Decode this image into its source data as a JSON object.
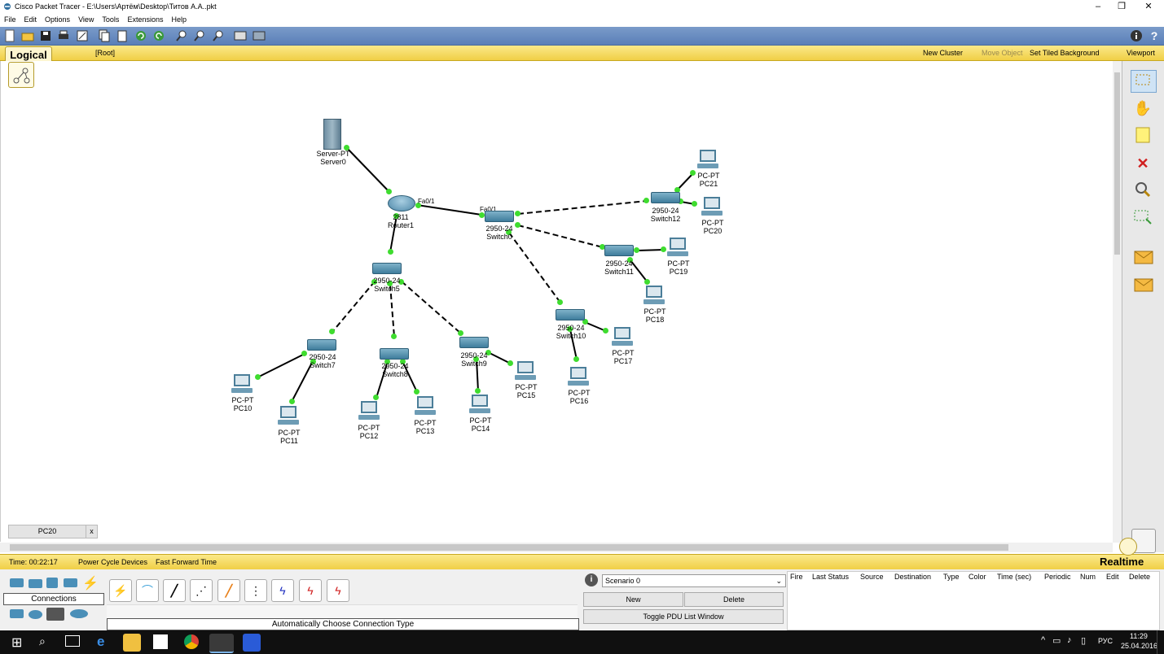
{
  "window": {
    "title": "Cisco Packet Tracer - E:\\Users\\Артём\\Desktop\\Титов А.А..pkt",
    "controls": [
      "–",
      "❐",
      "✕"
    ]
  },
  "menu": [
    "File",
    "Edit",
    "Options",
    "View",
    "Tools",
    "Extensions",
    "Help"
  ],
  "logical_bar": {
    "tab": "Logical",
    "root": "[Root]",
    "new_cluster": "New Cluster",
    "move_object": "Move Object",
    "set_tiled_background": "Set Tiled Background",
    "viewport": "Viewport"
  },
  "devices": {
    "server0": {
      "type": "Server-PT",
      "name": "Server0"
    },
    "router1": {
      "type": "2811",
      "name": "Router1"
    },
    "switch0": {
      "type": "2950-24",
      "name": "Switch0"
    },
    "switch5": {
      "type": "2950-24",
      "name": "Switch5"
    },
    "switch7": {
      "type": "2950-24",
      "name": "Switch7"
    },
    "switch8": {
      "type": "2950-24",
      "name": "Switch8"
    },
    "switch9": {
      "type": "2950-24",
      "name": "Switch9"
    },
    "switch10": {
      "type": "2950-24",
      "name": "Switch10"
    },
    "switch11": {
      "type": "2950-24",
      "name": "Switch11"
    },
    "switch12": {
      "type": "2950-24",
      "name": "Switch12"
    },
    "pc10": {
      "type": "PC-PT",
      "name": "PC10"
    },
    "pc11": {
      "type": "PC-PT",
      "name": "PC11"
    },
    "pc12": {
      "type": "PC-PT",
      "name": "PC12"
    },
    "pc13": {
      "type": "PC-PT",
      "name": "PC13"
    },
    "pc14": {
      "type": "PC-PT",
      "name": "PC14"
    },
    "pc15": {
      "type": "PC-PT",
      "name": "PC15"
    },
    "pc16": {
      "type": "PC-PT",
      "name": "PC16"
    },
    "pc17": {
      "type": "PC-PT",
      "name": "PC17"
    },
    "pc18": {
      "type": "PC-PT",
      "name": "PC18"
    },
    "pc19": {
      "type": "PC-PT",
      "name": "PC19"
    },
    "pc20": {
      "type": "PC-PT",
      "name": "PC20"
    },
    "pc21": {
      "type": "PC-PT",
      "name": "PC21"
    }
  },
  "ports": {
    "router_fa01": "Fa0/1",
    "switch0_fa01": "Fa0/1"
  },
  "tooltip_tab": {
    "label": "PC20",
    "close": "x"
  },
  "status": {
    "time": "Time: 00:22:17",
    "power_cycle": "Power Cycle Devices",
    "fast_forward": "Fast Forward Time",
    "mode": "Realtime"
  },
  "bottom": {
    "category": "Connections",
    "connection_type": "Automatically Choose Connection Type",
    "scenario": "Scenario 0",
    "new": "New",
    "delete": "Delete",
    "toggle_pdu": "Toggle PDU List Window",
    "pdu_headers": [
      "Fire",
      "Last Status",
      "Source",
      "Destination",
      "Type",
      "Color",
      "Time (sec)",
      "Periodic",
      "Num",
      "Edit",
      "Delete"
    ]
  },
  "taskbar": {
    "time": "11:29",
    "date": "25.04.2016",
    "lang": "РУС"
  },
  "colors": {
    "accent": "#f0cf46",
    "toolbar": "#5a7fb8",
    "link_dot": "#3fdc2f"
  }
}
